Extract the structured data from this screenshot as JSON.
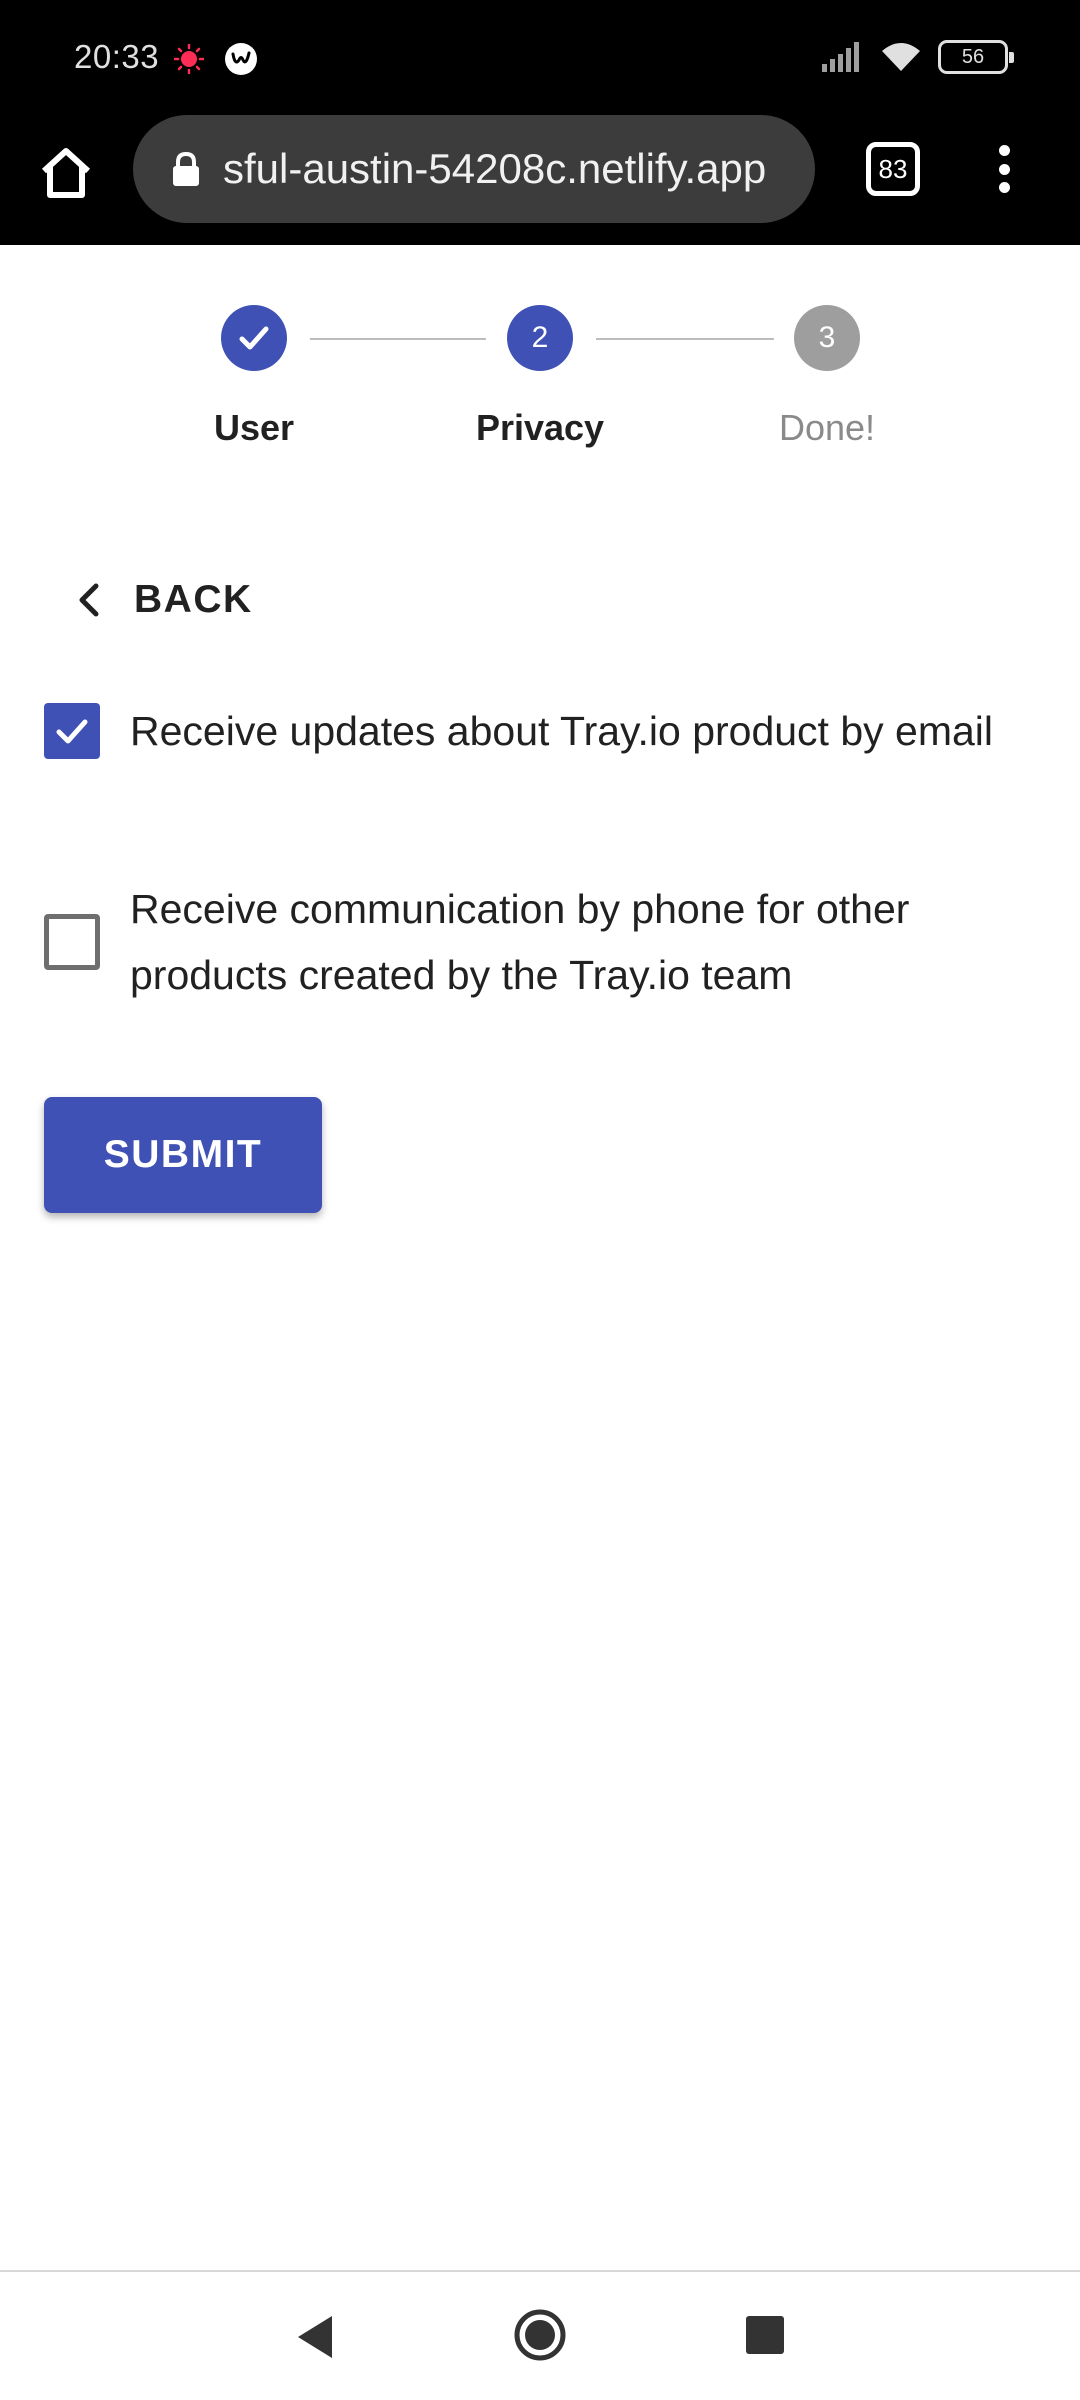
{
  "status_bar": {
    "time": "20:33",
    "battery_level": "56"
  },
  "browser": {
    "url": "sful-austin-54208c.netlify.app",
    "tab_count": "83"
  },
  "stepper": {
    "steps": [
      {
        "number": "1",
        "label": "User",
        "state": "completed"
      },
      {
        "number": "2",
        "label": "Privacy",
        "state": "active"
      },
      {
        "number": "3",
        "label": "Done!",
        "state": "inactive"
      }
    ]
  },
  "form": {
    "back_label": "BACK",
    "options": [
      {
        "text": "Receive updates about Tray.io product by email",
        "checked": true
      },
      {
        "text": "Receive communication by phone for other products created by the Tray.io team",
        "checked": false
      }
    ],
    "submit_label": "SUBMIT"
  },
  "colors": {
    "primary": "#3f51b5",
    "inactive_step": "#9e9e9e"
  }
}
